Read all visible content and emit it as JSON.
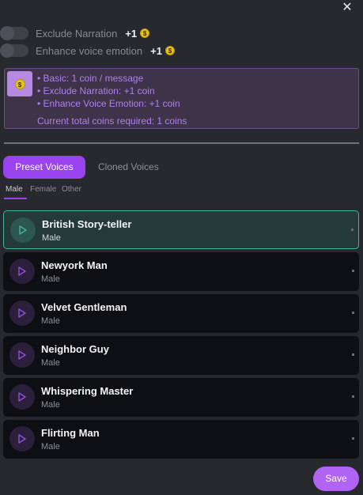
{
  "close_glyph": "✕",
  "toggles": [
    {
      "label": "Exclude Narration",
      "cost": "+1"
    },
    {
      "label": "Enhance voice emotion",
      "cost": "+1"
    }
  ],
  "coin_glyph": "$",
  "info": {
    "lines": [
      "• Basic: 1 coin / message",
      "• Exclude Narration: +1 coin",
      "• Enhance Voice Emotion: +1 coin"
    ],
    "total": "Current total coins required: 1 coins"
  },
  "tabs": {
    "preset": "Preset Voices",
    "cloned": "Cloned Voices"
  },
  "gender_tabs": [
    "Male",
    "Female",
    "Other"
  ],
  "voices": [
    {
      "name": "British Story-teller",
      "gender": "Male"
    },
    {
      "name": "Newyork Man",
      "gender": "Male"
    },
    {
      "name": "Velvet Gentleman",
      "gender": "Male"
    },
    {
      "name": "Neighbor Guy",
      "gender": "Male"
    },
    {
      "name": "Whispering Master",
      "gender": "Male"
    },
    {
      "name": "Flirting Man",
      "gender": "Male"
    }
  ],
  "save_label": "Save",
  "colors": {
    "accent": "#9a44f0",
    "selected_border": "#3fb49c",
    "info_text": "#b27ff0",
    "coin": "#e6c21a"
  }
}
